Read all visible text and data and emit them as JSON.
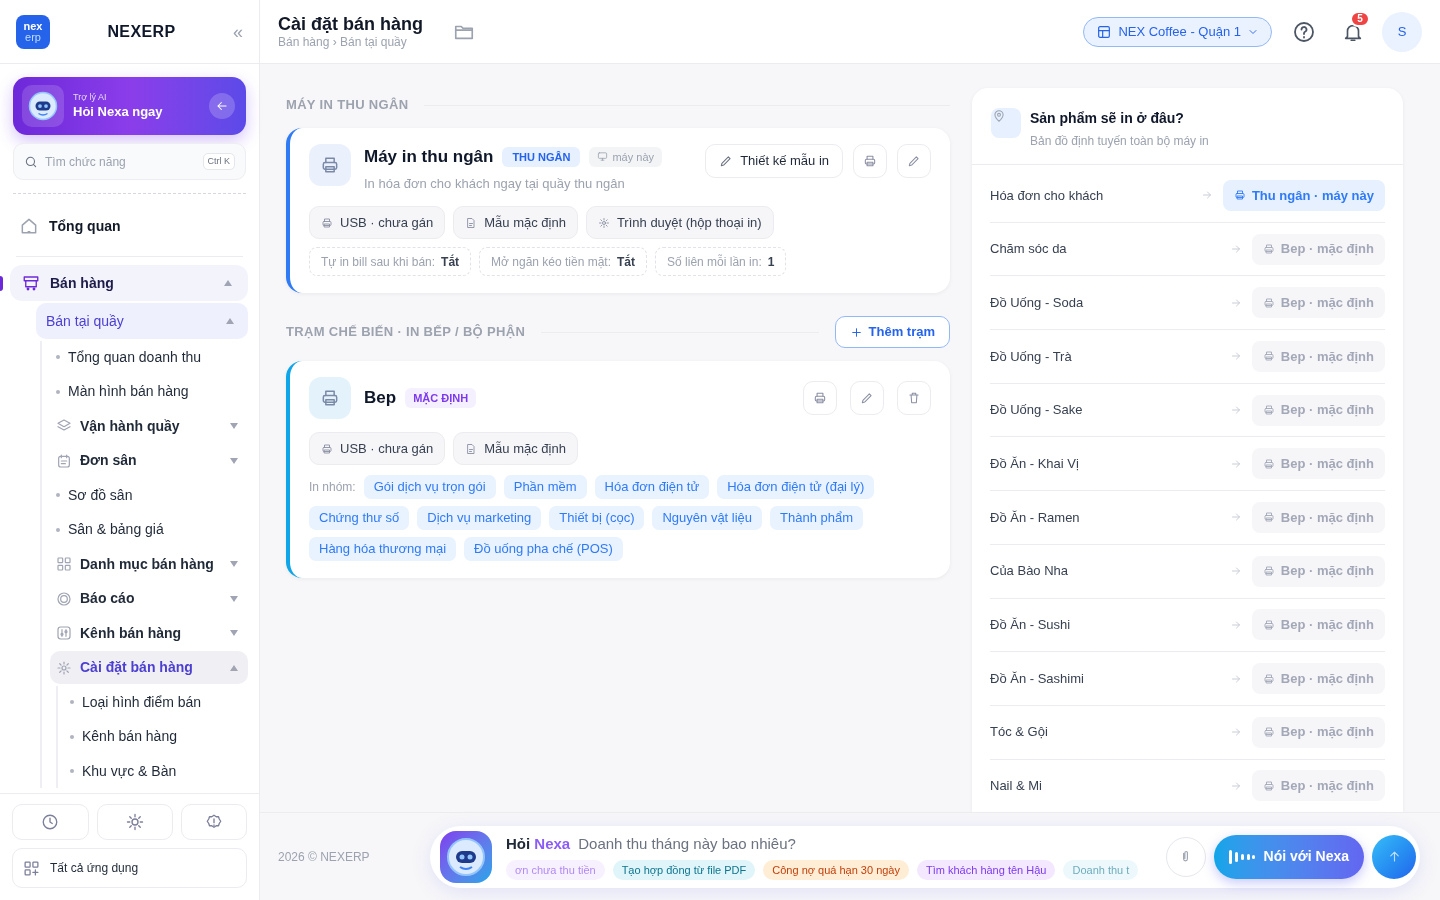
{
  "brand": {
    "logo_top": "nex",
    "logo_bottom": "erp",
    "name": "NEXERP",
    "collapse": "«"
  },
  "ai_card": {
    "eyebrow": "Trợ lý AI",
    "title": "Hỏi Nexa ngay"
  },
  "search": {
    "placeholder": "Tìm chức năng",
    "shortcut": "Ctrl K"
  },
  "nav": [
    {
      "label": "Tổng quan",
      "kind": "top",
      "selected": false
    },
    {
      "label": "Bán hàng",
      "kind": "group",
      "selected": true,
      "expanded": true,
      "children": [
        {
          "label": "Bán tại quầy",
          "kind": "sub",
          "selected": true,
          "expanded": true,
          "children": [
            {
              "label": "Tổng quan doanh thu",
              "kind": "link",
              "selected": false
            },
            {
              "label": "Màn hình bán hàng",
              "kind": "link",
              "selected": false
            },
            {
              "label": "Vận hành quầy",
              "kind": "group",
              "selected": false,
              "expanded": false
            },
            {
              "label": "Đơn sân",
              "kind": "group",
              "selected": false,
              "expanded": false
            },
            {
              "label": "Sơ đồ sân",
              "kind": "link",
              "selected": false
            },
            {
              "label": "Sân & bảng giá",
              "kind": "link",
              "selected": false
            },
            {
              "label": "Danh mục bán hàng",
              "kind": "group",
              "selected": false,
              "expanded": false
            },
            {
              "label": "Báo cáo",
              "kind": "group",
              "selected": false,
              "expanded": false
            },
            {
              "label": "Kênh bán hàng",
              "kind": "group",
              "selected": false,
              "expanded": false
            },
            {
              "label": "Cài đặt bán hàng",
              "kind": "group",
              "selected": true,
              "expanded": true,
              "children": [
                {
                  "label": "Loại hình điểm bán",
                  "kind": "link",
                  "selected": false
                },
                {
                  "label": "Kênh bán hàng",
                  "kind": "link",
                  "selected": false
                },
                {
                  "label": "Khu vực & Bàn",
                  "kind": "link",
                  "selected": false
                }
              ]
            }
          ]
        }
      ]
    }
  ],
  "all_apps": "Tất cả ứng dụng",
  "header": {
    "title": "Cài đặt bán hàng",
    "breadcrumb": "Bán hàng › Bán tại quầy",
    "store": "NEX Coffee - Quận 1",
    "notifications": "5",
    "avatar": "S"
  },
  "cashier_section": {
    "title": "MÁY IN THU NGÂN",
    "printer": {
      "name": "Máy in thu ngân",
      "badge": "THU NGÂN",
      "device": "máy này",
      "description": "In hóa đơn cho khách ngay tại quầy thu ngân",
      "design_button": "Thiết kế mẫu in",
      "chips": [
        "USB · chưa gán",
        "Mẫu mặc định",
        "Trình duyệt (hộp thoại in)"
      ],
      "settings": [
        {
          "label": "Tự in bill sau khi bán:",
          "value": "Tắt"
        },
        {
          "label": "Mở ngăn kéo tiền mặt:",
          "value": "Tắt"
        },
        {
          "label": "Số liên mỗi lần in:",
          "value": "1"
        }
      ]
    }
  },
  "station_section": {
    "title": "TRẠM CHẾ BIẾN · IN BẾP / BỘ PHẬN",
    "add_button": "Thêm trạm",
    "stations": [
      {
        "name": "Bep",
        "badge": "MẶC ĐỊNH",
        "chips": [
          "USB · chưa gán",
          "Mẫu mặc định"
        ],
        "groups_label": "In nhóm:",
        "groups": [
          "Gói dịch vụ trọn gói",
          "Phần mềm",
          "Hóa đơn điện tử",
          "Hóa đơn điện tử (đại lý)",
          "Chứng thư số",
          "Dịch vụ marketing",
          "Thiết bị (cọc)",
          "Nguyên vật liệu",
          "Thành phẩm",
          "Hàng hóa thương mại",
          "Đồ uống pha chế (POS)"
        ]
      }
    ]
  },
  "routing": {
    "title": "Sản phẩm sẽ in ở đâu?",
    "subtitle": "Bản đồ định tuyến toàn bộ máy in",
    "rows": [
      {
        "label": "Hóa đơn cho khách",
        "target": "Thu ngân · máy này",
        "selected": true
      },
      {
        "label": "Chăm sóc da",
        "target": "Bep · mặc định",
        "selected": false
      },
      {
        "label": "Đồ Uống - Soda",
        "target": "Bep · mặc định",
        "selected": false
      },
      {
        "label": "Đồ Uống - Trà",
        "target": "Bep · mặc định",
        "selected": false
      },
      {
        "label": "Đồ Uống - Sake",
        "target": "Bep · mặc định",
        "selected": false
      },
      {
        "label": "Đồ Ăn - Khai Vị",
        "target": "Bep · mặc định",
        "selected": false
      },
      {
        "label": "Đồ Ăn - Ramen",
        "target": "Bep · mặc định",
        "selected": false
      },
      {
        "label": "Của Bào Nha",
        "target": "Bep · mặc định",
        "selected": false
      },
      {
        "label": "Đồ Ăn - Sushi",
        "target": "Bep · mặc định",
        "selected": false
      },
      {
        "label": "Đồ Ăn - Sashimi",
        "target": "Bep · mặc định",
        "selected": false
      },
      {
        "label": "Tóc & Gội",
        "target": "Bep · mặc định",
        "selected": false
      },
      {
        "label": "Nail & Mi",
        "target": "Bep · mặc định",
        "selected": false
      }
    ]
  },
  "footer": {
    "copyright": "2026 © NEXERP"
  },
  "ask_bar": {
    "title_plain": "Hỏi",
    "title_accent": "Nexa",
    "question": "Doanh thu tháng này bao nhiêu?",
    "voice_button": "Nói với Nexa",
    "suggestions": [
      {
        "text": "ơn chưa thu tiền",
        "color": "#f3e8ff"
      },
      {
        "text": "Tạo hợp đồng từ file PDF",
        "color": "#e0f5f9"
      },
      {
        "text": "Công nợ quá hạn 30 ngày",
        "color": "#ffedd5"
      },
      {
        "text": "Tìm khách hàng tên Hậu",
        "color": "#f3e8ff"
      },
      {
        "text": "Doanh thu t",
        "color": "#e0f5f9"
      }
    ]
  }
}
